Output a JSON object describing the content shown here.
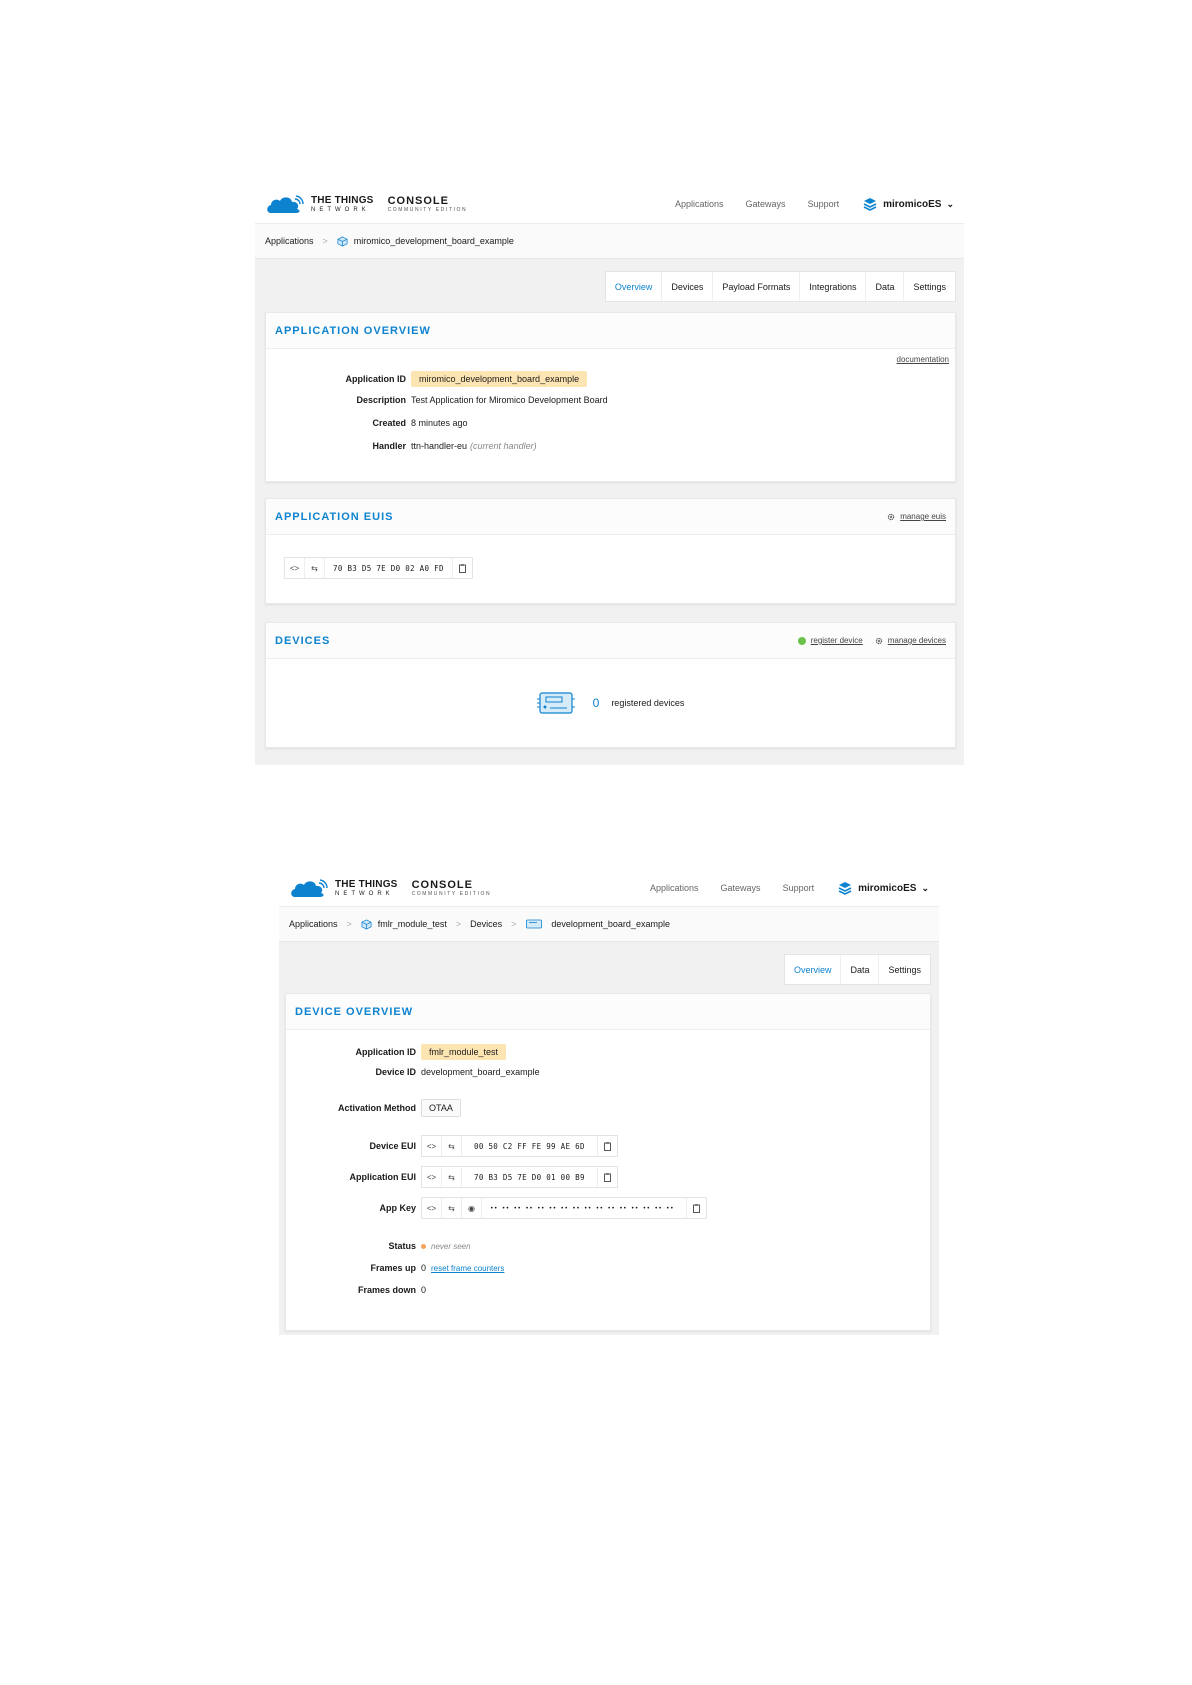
{
  "brand": {
    "name": "THE THINGS",
    "network": "NETWORK",
    "console": "CONSOLE",
    "edition": "COMMUNITY EDITION"
  },
  "nav": {
    "applications": "Applications",
    "gateways": "Gateways",
    "support": "Support",
    "user": "miromicoES"
  },
  "app_page": {
    "breadcrumb": {
      "root": "Applications",
      "app": "miromico_development_board_example"
    },
    "tabs": [
      "Overview",
      "Devices",
      "Payload Formats",
      "Integrations",
      "Data",
      "Settings"
    ],
    "overview": {
      "title": "APPLICATION OVERVIEW",
      "documentation": "documentation",
      "app_id_label": "Application ID",
      "app_id": "miromico_development_board_example",
      "description_label": "Description",
      "description": "Test Application for Miromico Development Board",
      "created_label": "Created",
      "created": "8 minutes ago",
      "handler_label": "Handler",
      "handler": "ttn-handler-eu",
      "handler_note": "(current handler)"
    },
    "euis": {
      "title": "APPLICATION EUIS",
      "manage": "manage euis",
      "eui": "70 B3 D5 7E D0 02 A0 FD"
    },
    "devices": {
      "title": "DEVICES",
      "register": "register device",
      "manage": "manage devices",
      "count": "0",
      "count_label": "registered devices"
    }
  },
  "device_page": {
    "breadcrumb": {
      "root": "Applications",
      "app": "fmlr_module_test",
      "devices": "Devices",
      "device": "development_board_example"
    },
    "tabs": [
      "Overview",
      "Data",
      "Settings"
    ],
    "overview": {
      "title": "DEVICE OVERVIEW",
      "app_id_label": "Application ID",
      "app_id": "fmlr_module_test",
      "device_id_label": "Device ID",
      "device_id": "development_board_example",
      "activation_label": "Activation Method",
      "activation": "OTAA",
      "dev_eui_label": "Device EUI",
      "dev_eui": "00 50 C2 FF FE 99 AE 6D",
      "app_eui_label": "Application EUI",
      "app_eui": "70 B3 D5 7E D0 01 00 B9",
      "app_key_label": "App Key",
      "app_key": "•• •• •• •• •• •• •• •• •• •• •• •• •• •• •• ••",
      "status_label": "Status",
      "status": "never seen",
      "frames_up_label": "Frames up",
      "frames_up": "0",
      "reset": "reset frame counters",
      "frames_down_label": "Frames down",
      "frames_down": "0"
    }
  },
  "colors": {
    "accent": "#0d83d0",
    "pill_bg": "#fde5b3",
    "pill_text": "#d28a17",
    "status_dot": "#f4a35a",
    "register_dot": "#6cc24a"
  }
}
